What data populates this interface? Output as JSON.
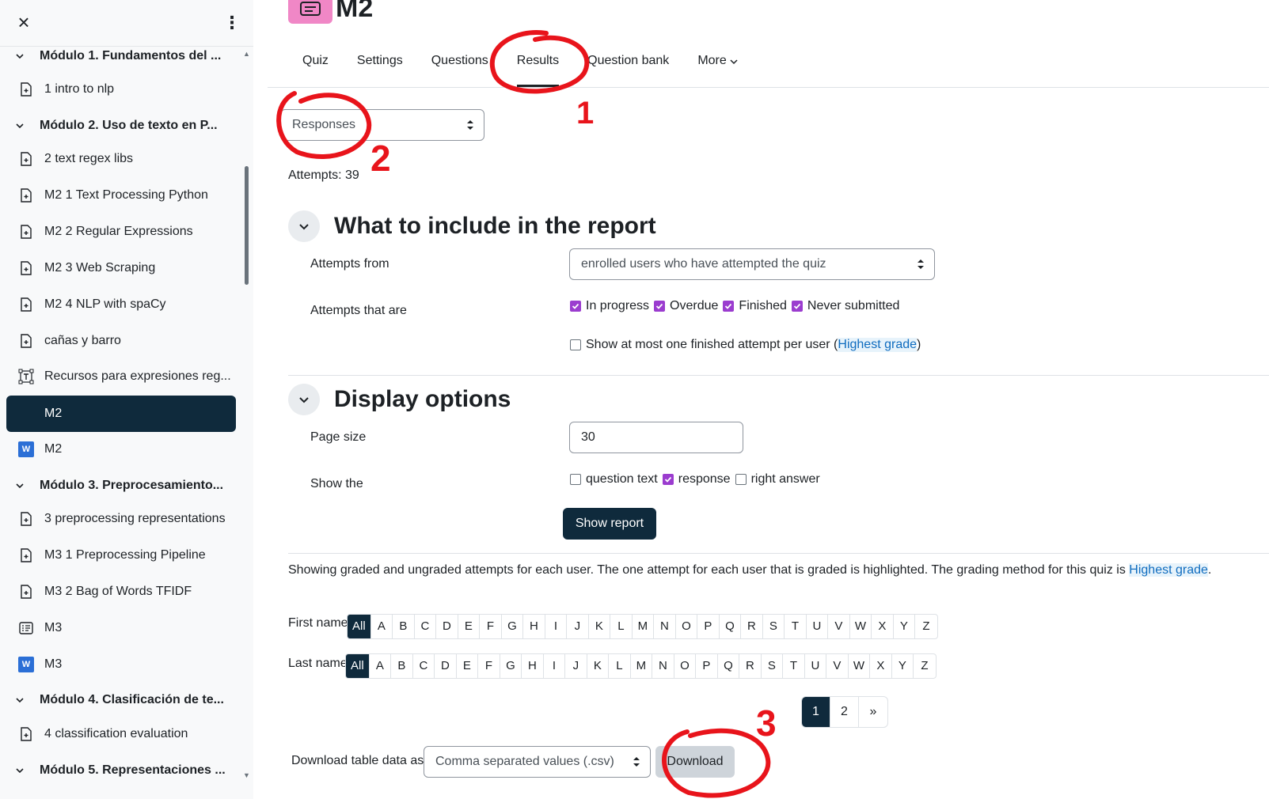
{
  "sidebar": {
    "close_label": "×",
    "menu_label": "⋮",
    "items": [
      {
        "label": "Módulo 1. Fundamentos del ...",
        "kind": "section"
      },
      {
        "label": "1 intro to nlp",
        "kind": "page"
      },
      {
        "label": "Módulo 2. Uso de texto en P...",
        "kind": "section"
      },
      {
        "label": "2 text regex libs",
        "kind": "page"
      },
      {
        "label": "M2 1 Text Processing Python",
        "kind": "page"
      },
      {
        "label": "M2 2 Regular Expressions",
        "kind": "page"
      },
      {
        "label": "M2 3 Web Scraping",
        "kind": "page"
      },
      {
        "label": "M2 4 NLP with spaCy",
        "kind": "page"
      },
      {
        "label": "cañas y barro",
        "kind": "page"
      },
      {
        "label": "Recursos para expresiones reg...",
        "kind": "text"
      },
      {
        "label": "M2",
        "kind": "quiz",
        "active": true
      },
      {
        "label": "M2",
        "kind": "word"
      },
      {
        "label": "Módulo 3. Preprocesamiento...",
        "kind": "section"
      },
      {
        "label": "3 preprocessing representations",
        "kind": "page"
      },
      {
        "label": "M3 1 Preprocessing Pipeline",
        "kind": "page"
      },
      {
        "label": "M3 2 Bag of Words TFIDF",
        "kind": "page"
      },
      {
        "label": "M3",
        "kind": "quiz"
      },
      {
        "label": "M3",
        "kind": "word"
      },
      {
        "label": "Módulo 4. Clasificación de te...",
        "kind": "section"
      },
      {
        "label": "4 classification evaluation",
        "kind": "page"
      },
      {
        "label": "Módulo 5. Representaciones ...",
        "kind": "section"
      }
    ]
  },
  "header": {
    "title": "M2"
  },
  "tabs": [
    {
      "label": "Quiz"
    },
    {
      "label": "Settings"
    },
    {
      "label": "Questions"
    },
    {
      "label": "Results",
      "active": true
    },
    {
      "label": "Question bank"
    },
    {
      "label": "More"
    }
  ],
  "report_select": {
    "value": "Responses"
  },
  "attempts_text": "Attempts: 39",
  "include_section": {
    "title": "What to include in the report",
    "attempts_from_label": "Attempts from",
    "attempts_from_value": "enrolled users who have attempted the quiz",
    "attempts_that_are_label": "Attempts that are",
    "states": [
      {
        "label": "In progress",
        "checked": true
      },
      {
        "label": "Overdue",
        "checked": true
      },
      {
        "label": "Finished",
        "checked": true
      },
      {
        "label": "Never submitted",
        "checked": true
      }
    ],
    "one_attempt_label_pre": "Show at most one finished attempt per user (",
    "one_attempt_link": "Highest grade",
    "one_attempt_label_post": ")"
  },
  "display_section": {
    "title": "Display options",
    "page_size_label": "Page size",
    "page_size_value": "30",
    "show_the_label": "Show the",
    "show_options": [
      {
        "label": "question text",
        "checked": false
      },
      {
        "label": "response",
        "checked": true
      },
      {
        "label": "right answer",
        "checked": false
      }
    ],
    "show_report_label": "Show report"
  },
  "info": {
    "text": "Showing graded and ungraded attempts for each user. The one attempt for each user that is graded is highlighted. The grading method for this quiz is ",
    "link": "Highest grade",
    "end": "."
  },
  "initials": {
    "first_name_label": "First name",
    "last_name_label": "Last name",
    "letters": [
      "All",
      "A",
      "B",
      "C",
      "D",
      "E",
      "F",
      "G",
      "H",
      "I",
      "J",
      "K",
      "L",
      "M",
      "N",
      "O",
      "P",
      "Q",
      "R",
      "S",
      "T",
      "U",
      "V",
      "W",
      "X",
      "Y",
      "Z"
    ]
  },
  "pagination": {
    "pages": [
      "1",
      "2",
      "»"
    ],
    "current": "1"
  },
  "download": {
    "label": "Download table data as",
    "format_value": "Comma separated values (.csv)",
    "button_label": "Download"
  },
  "annotations": {
    "marks": [
      "1",
      "2",
      "3"
    ],
    "color": "#e8141b"
  },
  "colors": {
    "accent_dark": "#0f2a3c",
    "checkbox": "#9b3ccf",
    "link": "#0f6cbf",
    "quiz_icon_bg": "#f087c6"
  }
}
